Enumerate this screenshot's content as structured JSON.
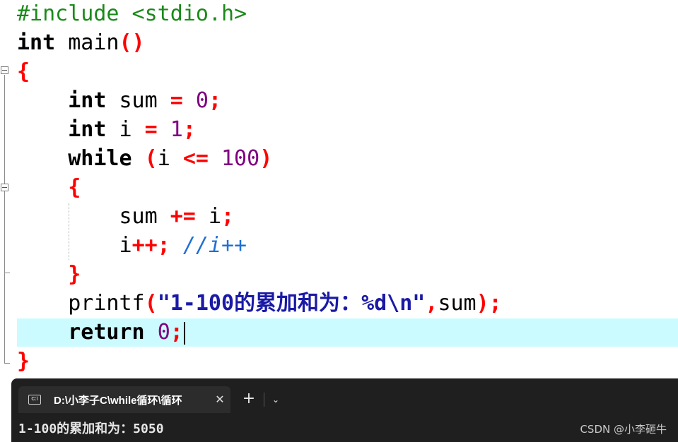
{
  "code": {
    "l1": {
      "a": "#include <stdio.h>"
    },
    "l2": {
      "kw": "int",
      "fn": " main",
      "op": "()"
    },
    "l3": {
      "op": "{"
    },
    "l4": {
      "indent": "    ",
      "kw": "int",
      "id": " sum ",
      "op1": "=",
      "sp": " ",
      "num": "0",
      "op2": ";"
    },
    "l5": {
      "indent": "    ",
      "kw": "int",
      "id": " i ",
      "op1": "=",
      "sp": " ",
      "num": "1",
      "op2": ";"
    },
    "l6": {
      "indent": "    ",
      "kw": "while",
      "sp": " ",
      "op1": "(",
      "id": "i ",
      "op2": "<=",
      "sp2": " ",
      "num": "100",
      "op3": ")"
    },
    "l7": {
      "indent": "    ",
      "op": "{"
    },
    "l8": {
      "indent": "        ",
      "id": "sum ",
      "op1": "+=",
      "id2": " i",
      "op2": ";"
    },
    "l9": {
      "indent": "        ",
      "id": "i",
      "op1": "++;",
      "sp": " ",
      "cmt": "//i++"
    },
    "l10": {
      "indent": "    ",
      "op": "}"
    },
    "l11": {
      "indent": "    ",
      "fn": "printf",
      "op1": "(",
      "str1": "\"1-100",
      "str_cn": "的累加和为：",
      "str2": "%d\\n\"",
      "op2": ",",
      "id": "sum",
      "op3": ");"
    },
    "l12": {
      "indent": "    ",
      "kw": "return",
      "sp": " ",
      "num": "0",
      "op": ";"
    },
    "l13": {
      "op": "}"
    }
  },
  "terminal": {
    "tab_title": "D:\\小李子C\\while循环\\循环",
    "tab_icon_label": "C:\\",
    "close_glyph": "✕",
    "new_tab_glyph": "+",
    "dropdown_glyph": "⌄",
    "output": "1-100的累加和为：5050"
  },
  "watermark": "CSDN @小李砸牛"
}
